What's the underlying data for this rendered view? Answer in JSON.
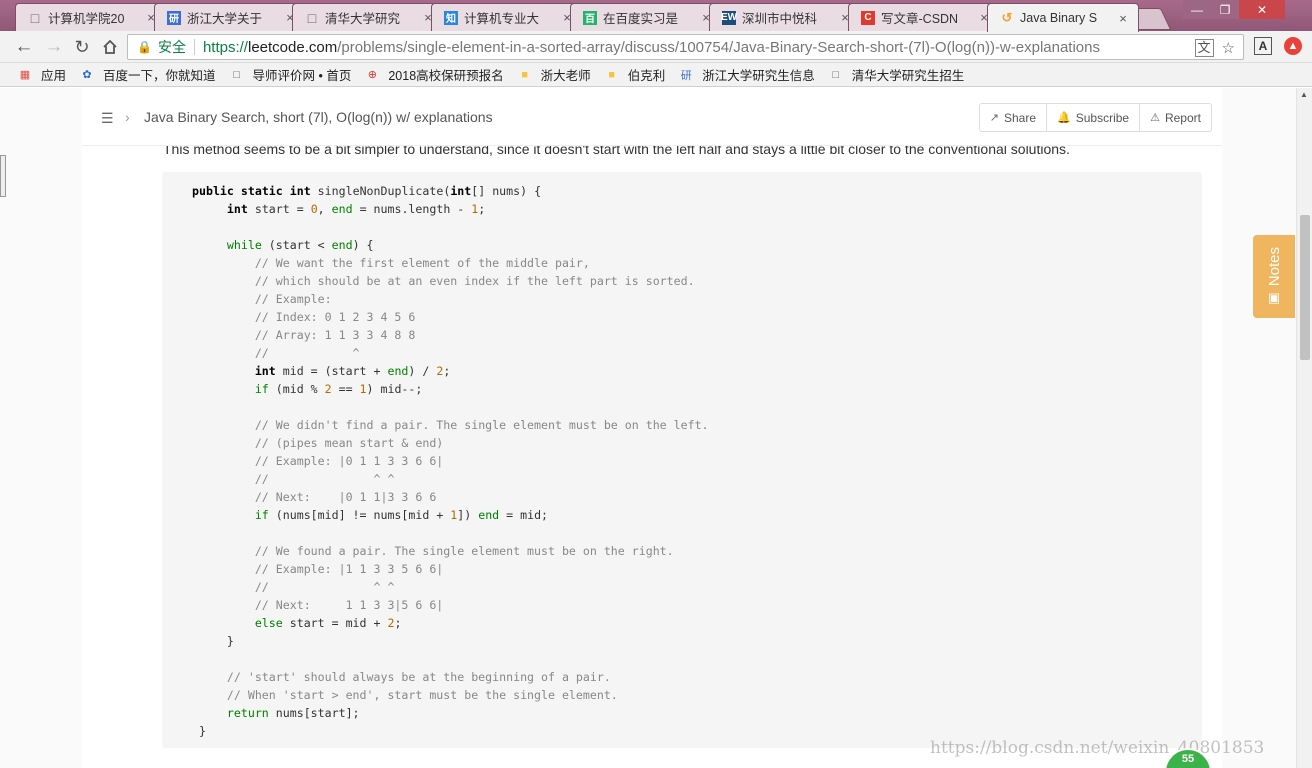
{
  "browser": {
    "tabs": [
      {
        "title": "计算机学院20",
        "icon": "doc-icon",
        "color": "#666666"
      },
      {
        "title": "浙江大学关于",
        "icon": "yan-icon",
        "color": "#3b6fd6"
      },
      {
        "title": "清华大学研究",
        "icon": "doc-icon",
        "color": "#666666"
      },
      {
        "title": "计算机专业大",
        "icon": "zhi-icon",
        "color": "#2b88d8"
      },
      {
        "title": "在百度实习是",
        "icon": "bai-icon",
        "color": "#25b36c"
      },
      {
        "title": "深圳市中悦科",
        "icon": "ew-icon",
        "color": "#1b4e7c"
      },
      {
        "title": "写文章-CSDN",
        "icon": "csdn-icon",
        "color": "#e03a2f"
      },
      {
        "title": "Java Binary S",
        "icon": "leetcode-icon",
        "color": "#f0a232",
        "active": true
      }
    ],
    "tab_close": "×",
    "window": {
      "min": "—",
      "max": "❐",
      "close": "✕"
    },
    "secure_label": "安全",
    "url": {
      "scheme": "https://",
      "host": "leetcode.com",
      "path": "/problems/single-element-in-a-sorted-array/discuss/100754/Java-Binary-Search-short-(7l)-O(log(n))-w-explanations"
    },
    "bookmarks": [
      {
        "label": "应用",
        "icon": "apps-icon"
      },
      {
        "label": "百度一下，你就知道",
        "icon": "baidu-paw-icon"
      },
      {
        "label": "导师评价网 • 首页",
        "icon": "doc-icon"
      },
      {
        "label": "2018高校保研预报名",
        "icon": "target-icon"
      },
      {
        "label": "浙大老师",
        "icon": "folder-icon"
      },
      {
        "label": "伯克利",
        "icon": "folder-icon"
      },
      {
        "label": "浙江大学研究生信息",
        "icon": "yan-icon"
      },
      {
        "label": "清华大学研究生招生",
        "icon": "doc-icon"
      }
    ]
  },
  "topic": {
    "title": "Java Binary Search, short (7l), O(log(n)) w/ explanations",
    "actions": {
      "share": "Share",
      "subscribe": "Subscribe",
      "report": "Report"
    }
  },
  "intro_text": "This method seems to be a bit simpler to understand, since it doesn't start with the left half and stays a little bit closer to the conventional solutions.",
  "code_lines": [
    "public static int singleNonDuplicate(int[] nums) {",
    "     int start = 0, end = nums.length - 1;",
    "",
    "     while (start < end) {",
    "         // We want the first element of the middle pair,",
    "         // which should be at an even index if the left part is sorted.",
    "         // Example:",
    "         // Index: 0 1 2 3 4 5 6",
    "         // Array: 1 1 3 3 4 8 8",
    "         //            ^",
    "         int mid = (start + end) / 2;",
    "         if (mid % 2 == 1) mid--;",
    "",
    "         // We didn't find a pair. The single element must be on the left.",
    "         // (pipes mean start & end)",
    "         // Example: |0 1 1 3 3 6 6|",
    "         //               ^ ^",
    "         // Next:    |0 1 1|3 3 6 6",
    "         if (nums[mid] != nums[mid + 1]) end = mid;",
    "",
    "         // We found a pair. The single element must be on the right.",
    "         // Example: |1 1 3 3 5 6 6|",
    "         //               ^ ^",
    "         // Next:     1 1 3 3|5 6 6|",
    "         else start = mid + 2;",
    "     }",
    "",
    "     // 'start' should always be at the beginning of a pair.",
    "     // When 'start > end', start must be the single element.",
    "     return nums[start];",
    " }"
  ],
  "notes_label": "Notes",
  "watermark": "https://blog.csdn.net/weixin_40801853",
  "badge_count": "55"
}
